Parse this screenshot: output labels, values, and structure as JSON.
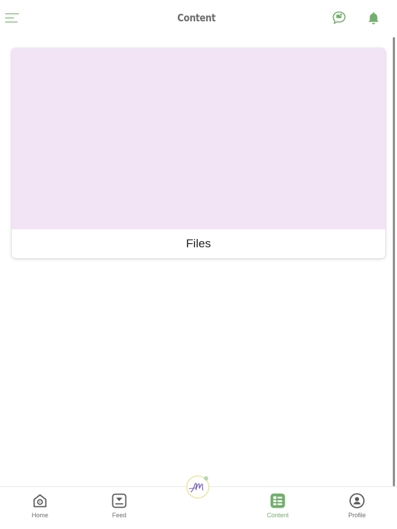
{
  "header": {
    "title": "Content",
    "menu_icon": "hamburger-menu-icon",
    "chat_icon": "chat-bubble-icon",
    "notification_icon": "bell-icon"
  },
  "main": {
    "cards": [
      {
        "label": "Files",
        "media_color": "#f2e4f4"
      }
    ]
  },
  "bottom_nav": {
    "items": [
      {
        "label": "Home",
        "icon": "home-icon",
        "active": false
      },
      {
        "label": "Feed",
        "icon": "feed-icon",
        "active": false
      },
      {
        "label": "Content",
        "icon": "content-icon",
        "active": true
      },
      {
        "label": "Profile",
        "icon": "profile-icon",
        "active": false
      }
    ],
    "center_logo": "app-logo"
  },
  "colors": {
    "accent": "#72ae6c",
    "title_text": "#6f6f6f",
    "card_media": "#f2e4f4",
    "logo_purple": "#7b63b6"
  }
}
